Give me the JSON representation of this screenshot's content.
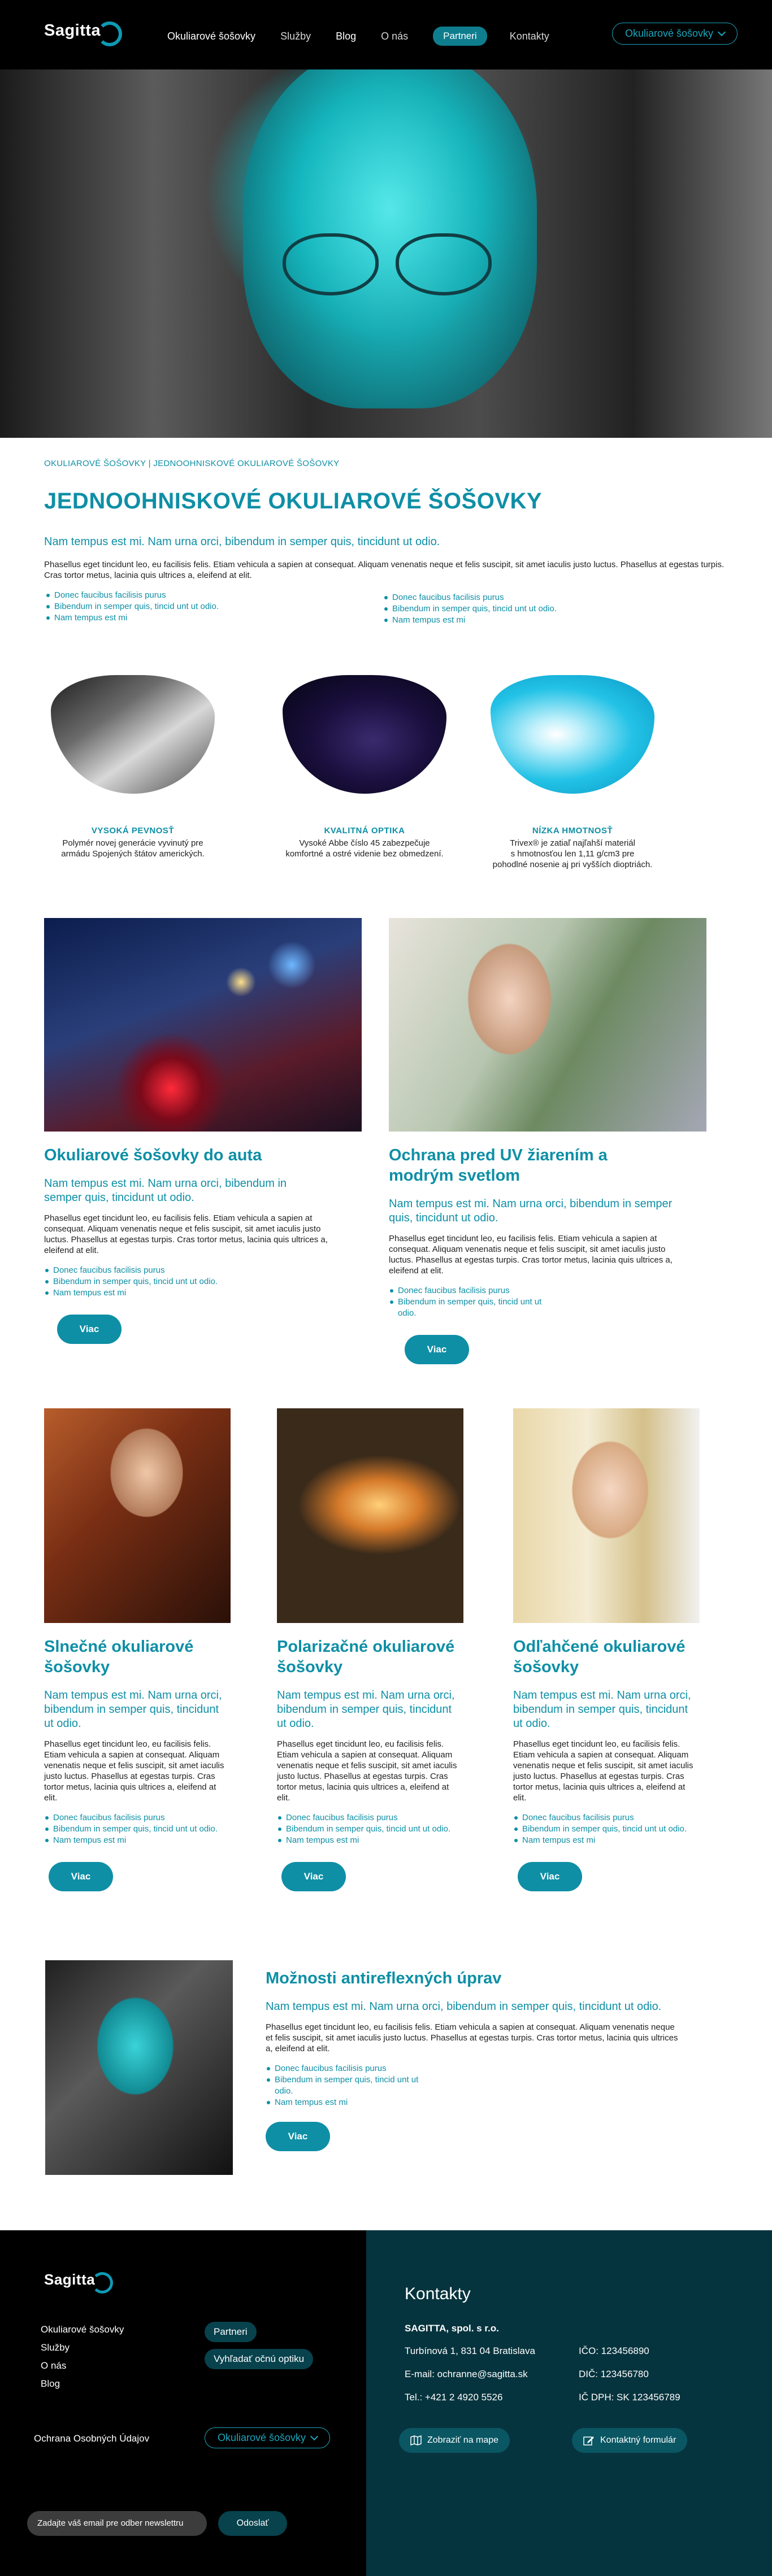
{
  "header": {
    "logo": "Sagitta",
    "nav": [
      "Okuliarové šošovky",
      "Služby",
      "Blog",
      "O nás"
    ],
    "nav_pill": "Partneri",
    "nav_contact": "Kontakty",
    "dropdown": "Okuliarové šošovky"
  },
  "breadcrumb": "OKULIAROVÉ ŠOŠOVKY | JEDNOOHNISKOVÉ OKULIAROVÉ ŠOŠOVKY",
  "page_title": "JEDNOOHNISKOVÉ OKULIAROVÉ ŠOŠOVKY",
  "intro": {
    "lead": "Nam tempus est mi. Nam urna orci, bibendum in semper quis, tincidunt ut odio.",
    "body": "Phasellus eget tincidunt leo, eu facilisis felis. Etiam vehicula a sapien at consequat. Aliquam venenatis neque et felis suscipit, sit amet iaculis justo luctus. Phasellus at egestas turpis. Cras tortor metus, lacinia quis ultrices a, eleifend at elit.",
    "bullets_left": [
      "Donec faucibus facilisis purus",
      "Bibendum in semper quis, tincid unt ut odio.",
      "Nam tempus est mi"
    ],
    "bullets_right": [
      "Donec faucibus facilisis purus",
      "Bibendum in semper quis, tincid unt ut odio.",
      "Nam tempus est mi"
    ]
  },
  "features": [
    {
      "title": "VYSOKÁ PEVNOSŤ",
      "text_lines": [
        "Polymér novej generácie vyvinutý pre",
        "armádu Spojených štátov amerických."
      ]
    },
    {
      "title": "KVALITNÁ OPTIKA",
      "text_lines": [
        "Vysoké Abbe číslo 45 zabezpečuje",
        "komfortné a ostré videnie bez obmedzení."
      ]
    },
    {
      "title": "NÍZKA HMOTNOSŤ",
      "text_lines": [
        "Trivex® je zatiaľ najľahší materiál",
        "s hmotnosťou len 1,11 g/cm3 pre",
        "pohodlné nosenie aj pri vyšších dioptriách."
      ]
    }
  ],
  "cards": {
    "auto": {
      "title": "Okuliarové šošovky do auta",
      "lead": "Nam tempus est mi. Nam urna orci, bibendum in semper quis, tincidunt ut odio.",
      "body": "Phasellus eget tincidunt leo, eu facilisis felis. Etiam vehicula a sapien at consequat. Aliquam venenatis neque et felis suscipit, sit amet iaculis justo luctus. Phasellus at egestas turpis. Cras tortor metus, lacinia quis ultrices a, eleifend at elit.",
      "bullets": [
        "Donec faucibus facilisis purus",
        "Bibendum in semper quis, tincid unt ut odio.",
        "Nam tempus est mi"
      ],
      "button": "Viac"
    },
    "uv": {
      "title": "Ochrana pred UV žiarením a modrým svetlom",
      "lead": "Nam tempus est mi. Nam urna orci, bibendum in semper quis, tincidunt ut odio.",
      "body": "Phasellus eget tincidunt leo, eu facilisis felis. Etiam vehicula a sapien at consequat. Aliquam venenatis neque et felis suscipit, sit amet iaculis justo luctus. Phasellus at egestas turpis. Cras tortor metus, lacinia quis ultrices a, eleifend at elit.",
      "bullets": [
        "Donec faucibus facilisis purus",
        "Bibendum in semper quis, tincid unt ut odio."
      ],
      "button": "Viac"
    },
    "slnecne": {
      "title": "Slnečné okuliarové šošovky",
      "lead": "Nam tempus est mi. Nam urna orci, bibendum in semper quis, tincidunt ut odio.",
      "body": "Phasellus eget tincidunt leo, eu facilisis felis. Etiam vehicula a sapien at consequat. Aliquam venenatis neque et felis suscipit, sit amet iaculis justo luctus. Phasellus at egestas turpis. Cras tortor metus, lacinia quis ultrices a, eleifend at elit.",
      "bullets": [
        "Donec faucibus facilisis purus",
        "Bibendum in semper quis, tincid unt ut odio.",
        "Nam tempus est mi"
      ],
      "button": "Viac"
    },
    "polarizacne": {
      "title": "Polarizačné okuliarové šošovky",
      "lead": "Nam tempus est mi. Nam urna orci, bibendum in semper quis, tincidunt ut odio.",
      "body": "Phasellus eget tincidunt leo, eu facilisis felis. Etiam vehicula a sapien at consequat. Aliquam venenatis neque et felis suscipit, sit amet iaculis justo luctus. Phasellus at egestas turpis. Cras tortor metus, lacinia quis ultrices a, eleifend at elit.",
      "bullets": [
        "Donec faucibus facilisis purus",
        "Bibendum in semper quis, tincid unt ut odio.",
        "Nam tempus est mi"
      ],
      "button": "Viac"
    },
    "odlahcene": {
      "title": "Odľahčené okuliarové šošovky",
      "lead": "Nam tempus est mi. Nam urna orci, bibendum in semper quis, tincidunt ut odio.",
      "body": "Phasellus eget tincidunt leo, eu facilisis felis. Etiam vehicula a sapien at consequat. Aliquam venenatis neque et felis suscipit, sit amet iaculis justo luctus. Phasellus at egestas turpis. Cras tortor metus, lacinia quis ultrices a, eleifend at elit.",
      "bullets": [
        "Donec faucibus facilisis purus",
        "Bibendum in semper quis, tincid unt ut odio.",
        "Nam tempus est mi"
      ],
      "button": "Viac"
    },
    "antireflex": {
      "title": "Možnosti antireflexných úprav",
      "lead": "Nam tempus est mi. Nam urna orci, bibendum in semper quis, tincidunt ut odio.",
      "body": "Phasellus eget tincidunt leo, eu facilisis felis. Etiam vehicula a sapien at consequat. Aliquam venenatis neque et felis suscipit, sit amet iaculis justo luctus. Phasellus at egestas turpis. Cras tortor metus, lacinia quis ultrices a, eleifend at elit.",
      "bullets": [
        "Donec faucibus facilisis purus",
        "Bibendum in semper quis, tincid unt ut odio.",
        "Nam tempus est mi"
      ],
      "button": "Viac"
    }
  },
  "footer": {
    "logo": "Sagitta",
    "links": [
      "Okuliarové šošovky",
      "Služby",
      "O nás",
      "Blog"
    ],
    "partneri": "Partneri",
    "find_optician": "Vyhľadať očnú optiku",
    "privacy": "Ochrana Osobných Údajov",
    "dropdown": "Okuliarové šošovky",
    "newsletter_placeholder": "Zadajte váš email pre odber newslettru",
    "newsletter_button": "Odoslať"
  },
  "contacts": {
    "title": "Kontakty",
    "company": "SAGITTA, spol. s r.o.",
    "address": "Turbínová 1, 831 04  Bratislava",
    "email": "E-mail: ochranne@sagitta.sk",
    "phone": "Tel.: +421 2 4920 5526",
    "ico": "IČO: 123456890",
    "dic": "DIČ: 123456780",
    "icdph": "IČ DPH: SK 123456789",
    "map_button": "Zobraziť na mape",
    "form_button": "Kontaktný formulár"
  },
  "colors": {
    "accent": "#0e8fa6",
    "footer_dark": "#06343e",
    "header": "#000000"
  }
}
